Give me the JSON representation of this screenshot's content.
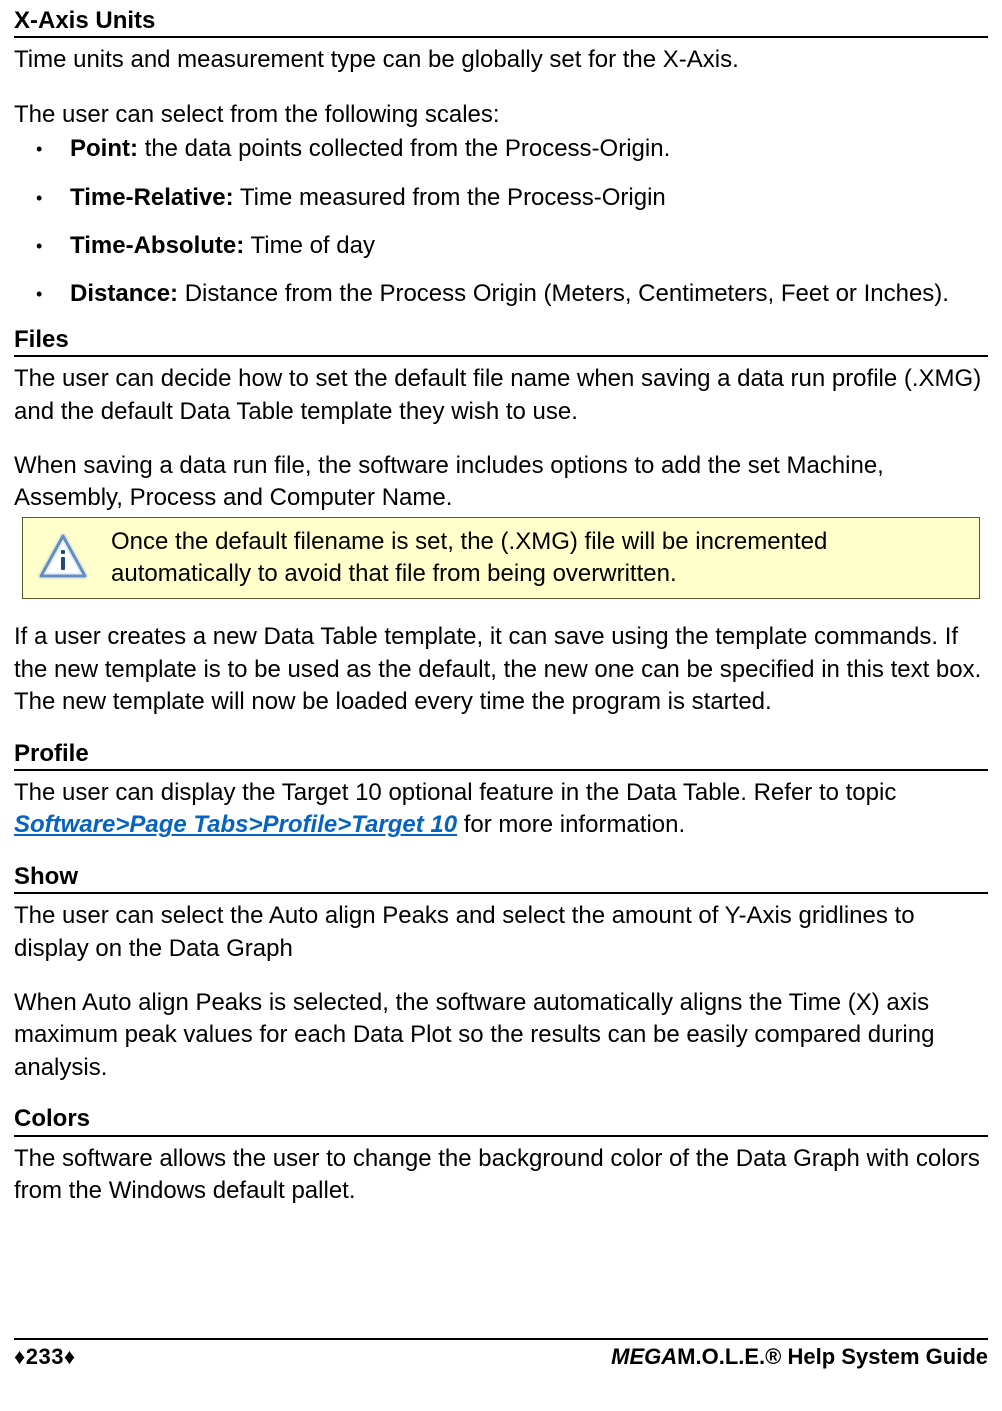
{
  "sections": {
    "xaxis": {
      "heading": "X-Axis Units",
      "intro": "Time units and measurement type can be globally set for the X-Axis.",
      "lead": "The user can select from the following scales:",
      "items": [
        {
          "label": "Point:",
          "text": " the data points collected from the Process-Origin."
        },
        {
          "label": "Time-Relative:",
          "text": " Time measured from the Process-Origin"
        },
        {
          "label": "Time-Absolute:",
          "text": " Time of day"
        },
        {
          "label": "Distance:",
          "text": " Distance from the Process Origin (Meters, Centimeters, Feet or Inches)."
        }
      ]
    },
    "files": {
      "heading": "Files",
      "p1": "The user can decide how to set the default file name when saving a data run profile (.XMG) and the default Data Table template they wish to use.",
      "p2": "When saving a data run file, the software includes options to add the set Machine, Assembly, Process and Computer Name.",
      "note": "Once the default filename is set, the (.XMG) file will be incremented automatically to avoid that file from being overwritten.",
      "p3": "If a user creates a new Data Table template, it can save using the template commands. If the new template is to be used as the default, the new one can be specified in this text box. The new template will now be loaded every time the program is started."
    },
    "profile": {
      "heading": "Profile",
      "pre": "The user can display the Target 10 optional feature in the Data Table. Refer to topic ",
      "link": "Software>Page Tabs>Profile>Target 10",
      "post": " for more information."
    },
    "show": {
      "heading": "Show",
      "p1": "The user can select the Auto align Peaks and select the amount of Y-Axis gridlines to display on the Data Graph",
      "p2": "When Auto align Peaks is selected, the software automatically aligns the Time (X) axis maximum peak values for each Data Plot so the results can be easily compared during analysis."
    },
    "colors": {
      "heading": "Colors",
      "p1": "The software allows the user to change the background color of the Data Graph with colors from the Windows default pallet."
    }
  },
  "footer": {
    "page": "♦233♦",
    "title_bold": "MEGA",
    "title_rest": "M.O.L.E.® Help System Guide"
  }
}
